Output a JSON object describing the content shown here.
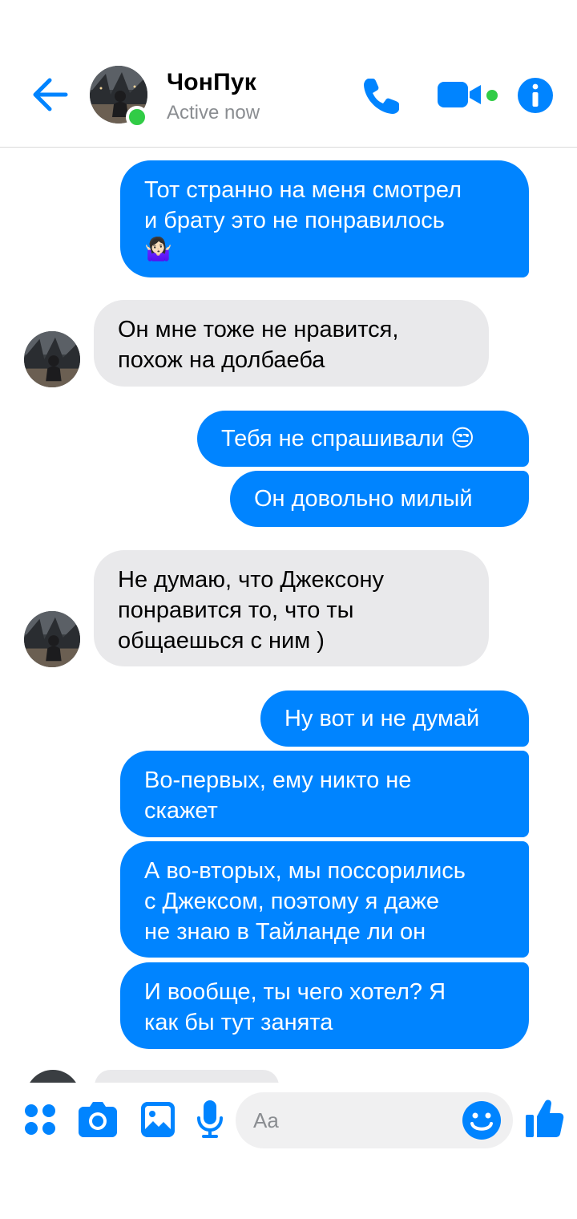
{
  "header": {
    "contact_name": "ЧонПук",
    "status": "Active now",
    "icons": {
      "back": "back-arrow-icon",
      "call": "phone-icon",
      "video": "video-camera-icon",
      "info": "info-icon"
    }
  },
  "messages": [
    {
      "direction": "outgoing",
      "lines": [
        "Тот странно на меня смотрел",
        "и брату это не понравилось"
      ],
      "emoji": "🤷🏻‍♀️"
    },
    {
      "direction": "incoming",
      "lines": [
        "Он мне тоже не нравится,",
        "похож на долбаеба"
      ]
    },
    {
      "direction": "outgoing",
      "lines": [
        "Тебя не спрашивали 😒"
      ]
    },
    {
      "direction": "outgoing",
      "lines": [
        "Он довольно милый"
      ]
    },
    {
      "direction": "incoming",
      "lines": [
        "Не думаю, что Джексону",
        "понравится то, что ты",
        "общаешься с ним )"
      ]
    },
    {
      "direction": "outgoing",
      "lines": [
        "Ну вот и не думай"
      ]
    },
    {
      "direction": "outgoing",
      "lines": [
        "Во-первых, ему никто не",
        "скажет"
      ]
    },
    {
      "direction": "outgoing",
      "lines": [
        "А во-вторых, мы поссорились",
        "с Джексом, поэтому я даже",
        "не знаю в Тайланде ли он"
      ]
    },
    {
      "direction": "outgoing",
      "lines": [
        "И вообще, ты чего хотел? Я",
        "как бы тут занята"
      ]
    }
  ],
  "composer": {
    "placeholder": "Aa",
    "icons": [
      "apps-icon",
      "camera-icon",
      "gallery-icon",
      "microphone-icon",
      "emoji-icon",
      "thumbs-up-icon"
    ]
  },
  "colors": {
    "accent": "#0084ff",
    "incoming_bubble": "#e9e9eb",
    "online": "#31cc46"
  }
}
